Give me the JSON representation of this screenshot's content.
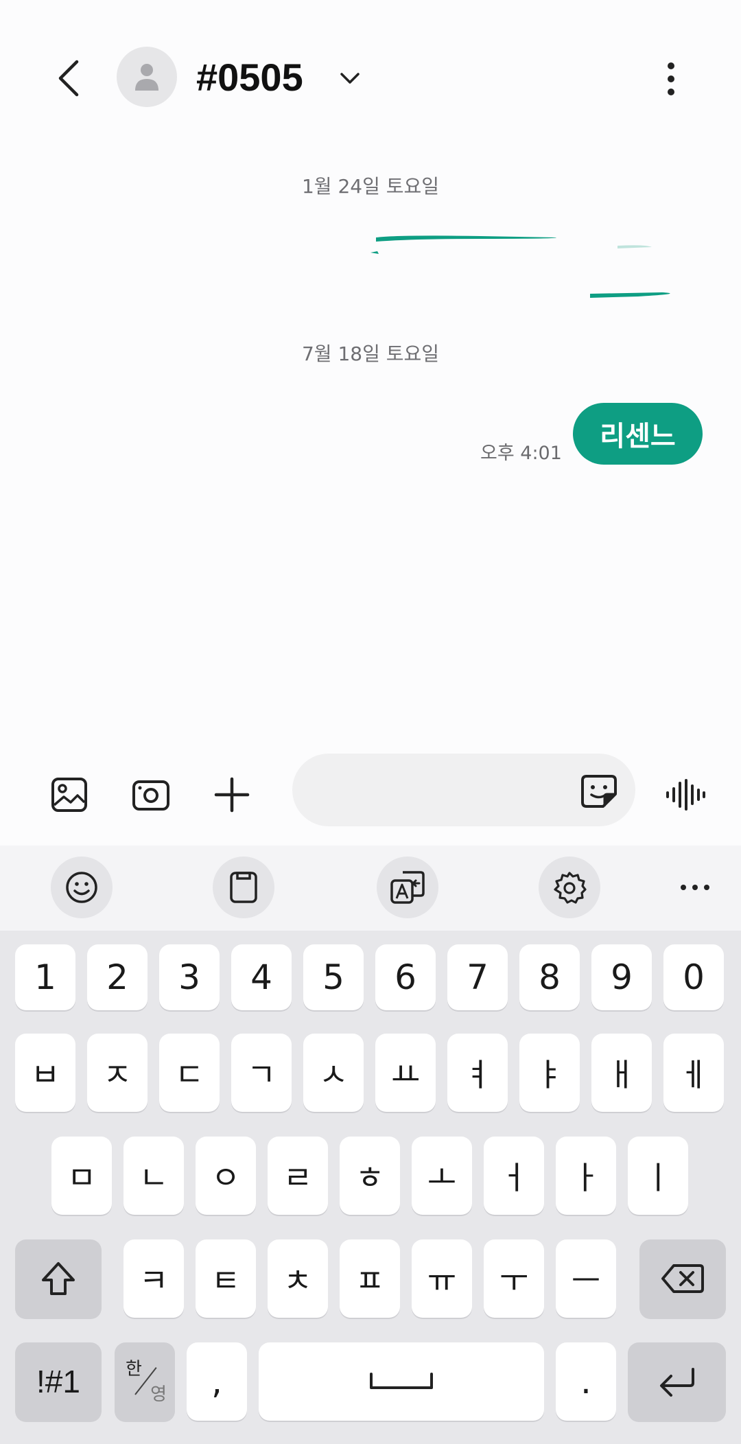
{
  "header": {
    "title": "#0505",
    "back_icon": "back-arrow-icon",
    "avatar_icon": "person-icon",
    "dropdown_icon": "chevron-down-icon",
    "more_icon": "more-vertical-icon"
  },
  "conversation": {
    "date_separators": [
      "1월 24일 토요일",
      "7월 18일 토요일"
    ],
    "messages": [
      {
        "text": "리센느",
        "time": "오후 4:01",
        "direction": "sent"
      }
    ]
  },
  "compose": {
    "input_value": "",
    "input_placeholder": "",
    "buttons": [
      "gallery-icon",
      "camera-icon",
      "plus-icon",
      "sticker-icon",
      "voice-icon"
    ]
  },
  "keyboard_toolbar": {
    "tools": [
      "emoji-icon",
      "clipboard-icon",
      "translate-icon",
      "settings-icon",
      "more-horizontal-icon"
    ]
  },
  "keyboard": {
    "number_row": [
      "1",
      "2",
      "3",
      "4",
      "5",
      "6",
      "7",
      "8",
      "9",
      "0"
    ],
    "row1": [
      "ㅂ",
      "ㅈ",
      "ㄷ",
      "ㄱ",
      "ㅅ",
      "ㅛ",
      "ㅕ",
      "ㅑ",
      "ㅐ",
      "ㅔ"
    ],
    "row2": [
      "ㅁ",
      "ㄴ",
      "ㅇ",
      "ㄹ",
      "ㅎ",
      "ㅗ",
      "ㅓ",
      "ㅏ",
      "ㅣ"
    ],
    "row3": [
      "ㅋ",
      "ㅌ",
      "ㅊ",
      "ㅍ",
      "ㅠ",
      "ㅜ",
      "ㅡ"
    ],
    "bottom": {
      "symbols": "!#1",
      "lang_han": "한",
      "lang_yeong": "영",
      "comma": ",",
      "period": "."
    }
  },
  "colors": {
    "accent": "#0e9e83",
    "background": "#fcfcfd",
    "keyboard_bg": "#e7e7ea",
    "key_bg": "#ffffff",
    "fn_key_bg": "#cfcfd3"
  }
}
